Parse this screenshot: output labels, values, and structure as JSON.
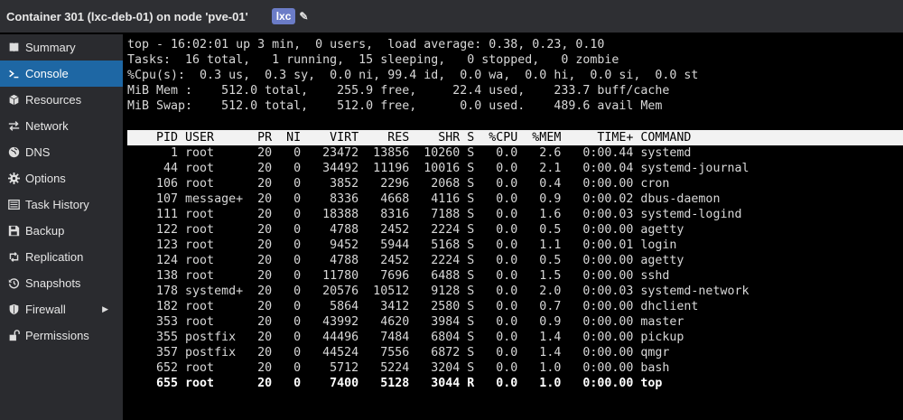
{
  "header": {
    "title": "Container 301 (lxc-deb-01) on node 'pve-01'",
    "tag": "lxc"
  },
  "sidebar": {
    "items": [
      {
        "label": "Summary",
        "icon": "book-icon"
      },
      {
        "label": "Console",
        "icon": "terminal-icon",
        "active": true
      },
      {
        "label": "Resources",
        "icon": "cube-icon"
      },
      {
        "label": "Network",
        "icon": "exchange-icon"
      },
      {
        "label": "DNS",
        "icon": "globe-icon"
      },
      {
        "label": "Options",
        "icon": "gear-icon"
      },
      {
        "label": "Task History",
        "icon": "list-icon"
      },
      {
        "label": "Backup",
        "icon": "floppy-icon"
      },
      {
        "label": "Replication",
        "icon": "retweet-icon"
      },
      {
        "label": "Snapshots",
        "icon": "history-icon"
      },
      {
        "label": "Firewall",
        "icon": "shield-icon"
      },
      {
        "label": "Permissions",
        "icon": "unlock-icon"
      }
    ]
  },
  "terminal": {
    "summary": [
      "top - 16:02:01 up 3 min,  0 users,  load average: 0.38, 0.23, 0.10",
      "Tasks:  16 total,   1 running,  15 sleeping,   0 stopped,   0 zombie",
      "%Cpu(s):  0.3 us,  0.3 sy,  0.0 ni, 99.4 id,  0.0 wa,  0.0 hi,  0.0 si,  0.0 st",
      "MiB Mem :    512.0 total,    255.9 free,     22.4 used,    233.7 buff/cache",
      "MiB Swap:    512.0 total,    512.0 free,      0.0 used.    489.6 avail Mem"
    ],
    "columns_header": "    PID USER      PR  NI    VIRT    RES    SHR S  %CPU  %MEM     TIME+ COMMAND",
    "processes": [
      "      1 root      20   0   23472  13856  10260 S   0.0   2.6   0:00.44 systemd",
      "     44 root      20   0   34492  11196  10016 S   0.0   2.1   0:00.04 systemd-journal",
      "    106 root      20   0    3852   2296   2068 S   0.0   0.4   0:00.00 cron",
      "    107 message+  20   0    8336   4668   4116 S   0.0   0.9   0:00.02 dbus-daemon",
      "    111 root      20   0   18388   8316   7188 S   0.0   1.6   0:00.03 systemd-logind",
      "    122 root      20   0    4788   2452   2224 S   0.0   0.5   0:00.00 agetty",
      "    123 root      20   0    9452   5944   5168 S   0.0   1.1   0:00.01 login",
      "    124 root      20   0    4788   2452   2224 S   0.0   0.5   0:00.00 agetty",
      "    138 root      20   0   11780   7696   6488 S   0.0   1.5   0:00.00 sshd",
      "    178 systemd+  20   0   20576  10512   9128 S   0.0   2.0   0:00.03 systemd-network",
      "    182 root      20   0    5864   3412   2580 S   0.0   0.7   0:00.00 dhclient",
      "    353 root      20   0   43992   4620   3984 S   0.0   0.9   0:00.00 master",
      "    355 postfix   20   0   44496   7484   6804 S   0.0   1.4   0:00.00 pickup",
      "    357 postfix   20   0   44524   7556   6872 S   0.0   1.4   0:00.00 qmgr",
      "    652 root      20   0    5712   5224   3204 S   0.0   1.0   0:00.00 bash"
    ],
    "running_process": "    655 root      20   0    7400   5128   3044 R   0.0   1.0   0:00.00 top"
  }
}
